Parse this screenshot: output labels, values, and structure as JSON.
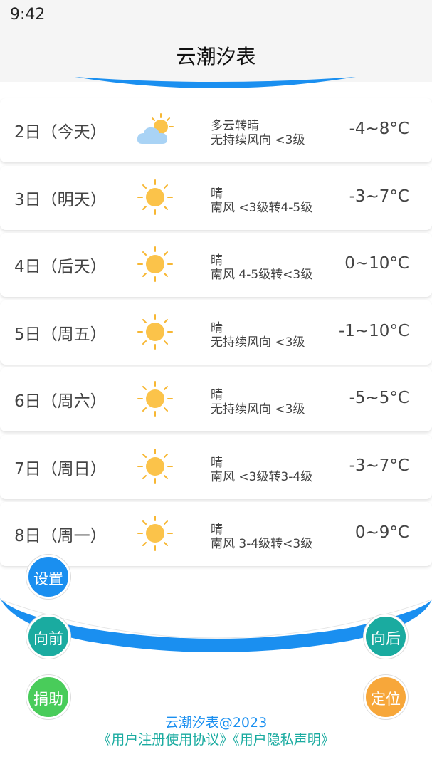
{
  "status_bar": {
    "time": "9:42"
  },
  "header": {
    "title": "云潮汐表"
  },
  "days": [
    {
      "day": "2日（今天）",
      "icon": "partly-cloudy-icon",
      "cond1": "多云转晴",
      "cond2": "无持续风向 <3级",
      "temp": "-4~8°C"
    },
    {
      "day": "3日（明天）",
      "icon": "sun-icon",
      "cond1": "晴",
      "cond2": "南风 <3级转4-5级",
      "temp": "-3~7°C"
    },
    {
      "day": "4日（后天）",
      "icon": "sun-icon",
      "cond1": "晴",
      "cond2": "南风 4-5级转<3级",
      "temp": "0~10°C"
    },
    {
      "day": "5日（周五）",
      "icon": "sun-icon",
      "cond1": "晴",
      "cond2": "无持续风向 <3级",
      "temp": "-1~10°C"
    },
    {
      "day": "6日（周六）",
      "icon": "sun-icon",
      "cond1": "晴",
      "cond2": "无持续风向 <3级",
      "temp": "-5~5°C"
    },
    {
      "day": "7日（周日）",
      "icon": "sun-icon",
      "cond1": "晴",
      "cond2": "南风 <3级转3-4级",
      "temp": "-3~7°C"
    },
    {
      "day": "8日（周一）",
      "icon": "sun-icon",
      "cond1": "晴",
      "cond2": "南风 3-4级转<3级",
      "temp": "0~9°C"
    }
  ],
  "buttons": {
    "settings": "设置",
    "forward": "向前",
    "back": "向后",
    "donate": "捐助",
    "locate": "定位"
  },
  "footer": {
    "title": "云潮汐表@2023",
    "user_agreement": "《用户注册使用协议》",
    "privacy": "《用户隐私声明》"
  },
  "colors": {
    "accent_blue": "#1a8ff0",
    "teal": "#1aaba0",
    "green": "#49cc5a",
    "orange": "#f7a73a"
  }
}
